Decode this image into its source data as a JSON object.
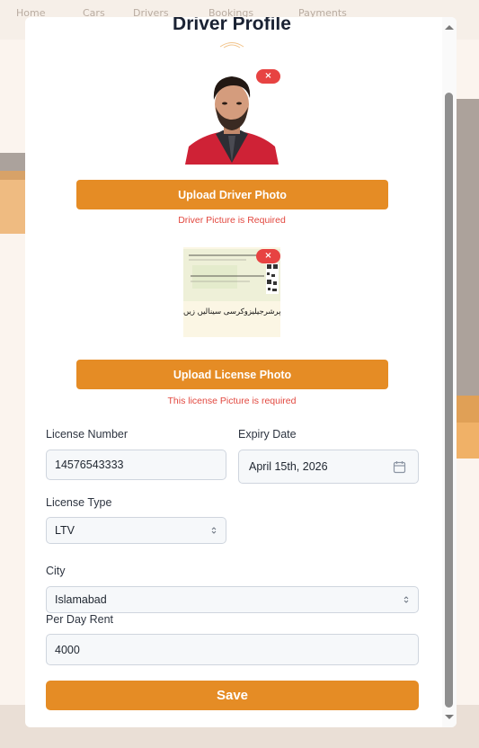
{
  "background": {
    "items": [
      "Home",
      "Cars",
      "Drivers",
      "Bookings",
      "Payments"
    ]
  },
  "modal": {
    "title": "Driver Profile",
    "driver_photo": {
      "remove_label": "×",
      "upload_label": "Upload Driver Photo",
      "error": "Driver Picture is Required"
    },
    "license_photo": {
      "remove_label": "×",
      "upload_label": "Upload License Photo",
      "error": "This license Picture is required",
      "urdu_text": "لشہ دکاردرمنے پرشرجیلیزوکرسی سینالیں زیں"
    },
    "form": {
      "license_number": {
        "label": "License Number",
        "value": "14576543333"
      },
      "expiry_date": {
        "label": "Expiry Date",
        "value": "April 15th, 2026"
      },
      "license_type": {
        "label": "License Type",
        "value": "LTV"
      },
      "city": {
        "label": "City",
        "value": "Islamabad"
      },
      "per_day_rent": {
        "label": "Per Day Rent",
        "value": "4000"
      }
    },
    "save_label": "Save"
  },
  "colors": {
    "accent": "#e58c25",
    "error": "#e2483f",
    "remove": "#e74342"
  }
}
